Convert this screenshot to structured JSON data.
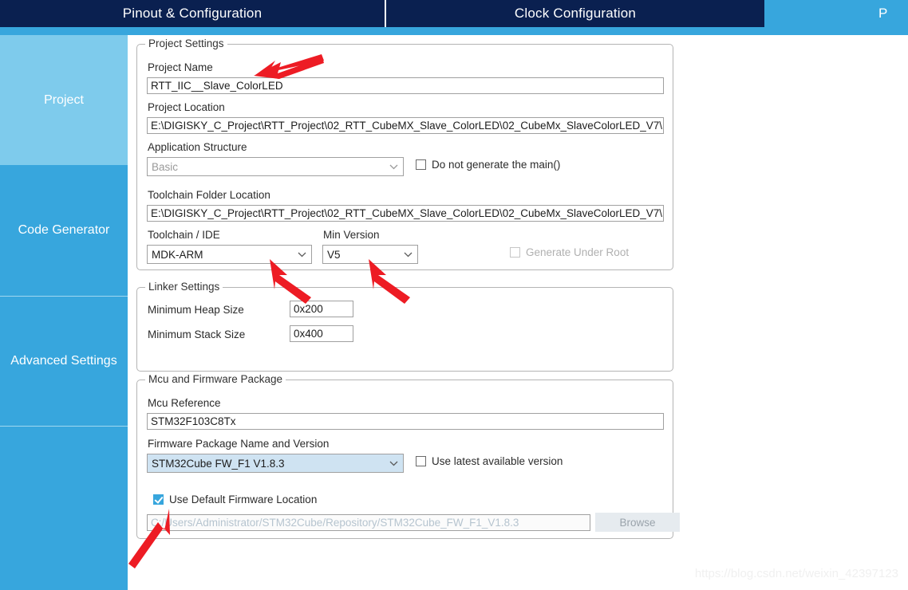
{
  "tabs": [
    {
      "label": "Pinout & Configuration",
      "active": false
    },
    {
      "label": "Clock Configuration",
      "active": false
    },
    {
      "label": "P",
      "active": true
    }
  ],
  "sidebar": {
    "items": [
      {
        "label": "Project",
        "active": true
      },
      {
        "label": "Code Generator",
        "active": false
      },
      {
        "label": "Advanced Settings",
        "active": false
      },
      {
        "label": "",
        "active": false
      }
    ]
  },
  "project_settings": {
    "legend": "Project Settings",
    "project_name_label": "Project Name",
    "project_name_value": "RTT_IIC__Slave_ColorLED",
    "project_location_label": "Project Location",
    "project_location_value": "E:\\DIGISKY_C_Project\\RTT_Project\\02_RTT_CubeMX_Slave_ColorLED\\02_CubeMx_SlaveColorLED_V7\\",
    "application_structure_label": "Application Structure",
    "application_structure_value": "Basic",
    "do_not_generate_main_label": "Do not generate the main()",
    "do_not_generate_main_checked": false,
    "toolchain_folder_label": "Toolchain Folder Location",
    "toolchain_folder_value": "E:\\DIGISKY_C_Project\\RTT_Project\\02_RTT_CubeMX_Slave_ColorLED\\02_CubeMx_SlaveColorLED_V7\\",
    "toolchain_ide_label": "Toolchain / IDE",
    "toolchain_ide_value": "MDK-ARM",
    "min_version_label": "Min Version",
    "min_version_value": "V5",
    "generate_under_root_label": "Generate Under Root",
    "generate_under_root_checked": false
  },
  "linker_settings": {
    "legend": "Linker Settings",
    "min_heap_label": "Minimum Heap Size",
    "min_heap_value": "0x200",
    "min_stack_label": "Minimum Stack Size",
    "min_stack_value": "0x400"
  },
  "mcu_firmware": {
    "legend": "Mcu and Firmware Package",
    "mcu_reference_label": "Mcu Reference",
    "mcu_reference_value": "STM32F103C8Tx",
    "firmware_package_label": "Firmware Package Name and Version",
    "firmware_package_value": "STM32Cube FW_F1 V1.8.3",
    "use_latest_label": "Use latest available version",
    "use_latest_checked": false,
    "use_default_location_label": "Use Default Firmware Location",
    "use_default_location_checked": true,
    "firmware_path_value": "C:/Users/Administrator/STM32Cube/Repository/STM32Cube_FW_F1_V1.8.3",
    "browse_label": "Browse"
  },
  "watermark": {
    "text": "https://blog.csdn.net/weixin_42397123"
  },
  "colors": {
    "tab_bar": "#0a2050",
    "accent": "#37a6dd",
    "accent_light": "#7ecbec",
    "annotation": "#ed1c24"
  }
}
